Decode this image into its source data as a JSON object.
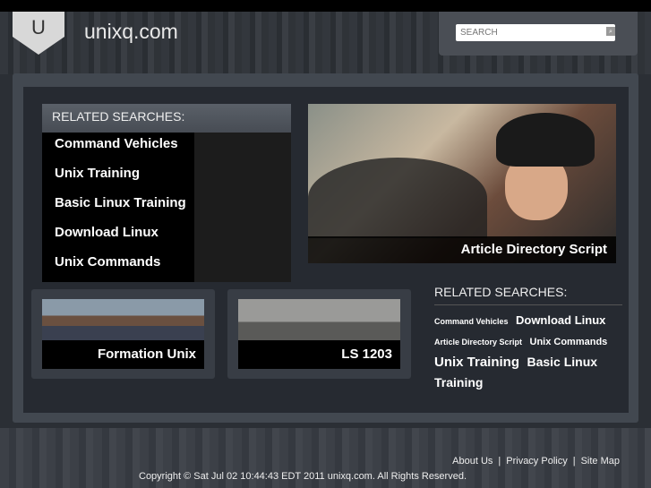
{
  "header": {
    "site_title": "unixq.com",
    "logo_letter": "U",
    "search_placeholder": "SEARCH"
  },
  "related": {
    "title": "RELATED SEARCHES:",
    "items": [
      "Command Vehicles",
      "Unix Training",
      "Basic Linux Training",
      "Download Linux",
      "Unix Commands"
    ]
  },
  "feature": {
    "caption": "Article Directory Script"
  },
  "thumbs": [
    {
      "caption": "Formation Unix"
    },
    {
      "caption": "LS 1203"
    }
  ],
  "cloud": {
    "title": "RELATED SEARCHES:",
    "tags": [
      {
        "label": "Command Vehicles",
        "size": 9
      },
      {
        "label": "Download Linux",
        "size": 13
      },
      {
        "label": "Article Directory Script",
        "size": 9
      },
      {
        "label": "Unix Commands",
        "size": 11
      },
      {
        "label": "Unix Training",
        "size": 15
      },
      {
        "label": "Basic Linux Training",
        "size": 14
      }
    ]
  },
  "footer": {
    "links": [
      "About Us",
      "Privacy Policy",
      "Site Map"
    ],
    "separator": "|",
    "copyright": "Copyright © Sat Jul 02 10:44:43 EDT 2011 unixq.com. All Rights Reserved."
  }
}
